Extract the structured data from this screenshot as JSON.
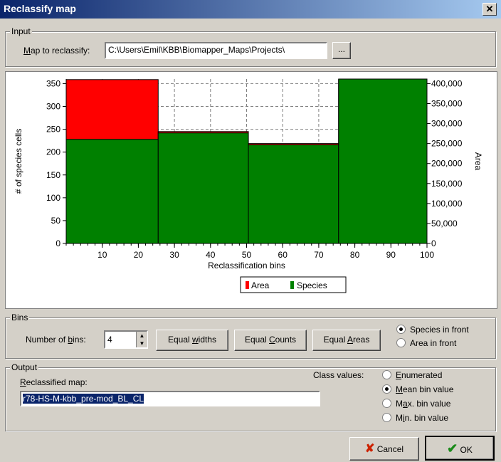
{
  "window": {
    "title": "Reclassify map",
    "close_glyph": "✕"
  },
  "input": {
    "group_label": "Input",
    "map_label_u": "M",
    "map_label_rest": "ap to reclassify:",
    "map_value": "C:\\Users\\Emil\\KBB\\Biomapper_Maps\\Projects\\",
    "browse_label": "..."
  },
  "chart_data": {
    "type": "bar",
    "xlabel": "Reclassification bins",
    "ylabel": "# of species cells",
    "y2label": "Area",
    "xlim": [
      0,
      100
    ],
    "ylim": [
      0,
      360
    ],
    "y2lim": [
      0,
      411429
    ],
    "xticks": [
      10,
      20,
      30,
      40,
      50,
      60,
      70,
      80,
      90,
      100
    ],
    "yticks": [
      0,
      50,
      100,
      150,
      200,
      250,
      300,
      350
    ],
    "y2ticks": [
      "0",
      "50,000",
      "100,000",
      "150,000",
      "200,000",
      "250,000",
      "300,000",
      "350,000",
      "400,000"
    ],
    "y2tick_values": [
      0,
      50000,
      100000,
      150000,
      200000,
      250000,
      300000,
      350000,
      400000
    ],
    "bins": [
      [
        0,
        25.5
      ],
      [
        25.5,
        50.5
      ],
      [
        50.5,
        75.5
      ],
      [
        75.5,
        100
      ]
    ],
    "series": [
      {
        "name": "Area",
        "color": "#ff0000",
        "axis": "right",
        "values": [
          410000,
          280000,
          250000,
          410000
        ]
      },
      {
        "name": "Species",
        "color": "#008000",
        "axis": "left",
        "values": [
          228,
          242,
          216,
          360
        ]
      }
    ],
    "grid": true,
    "legend_position": "bottom"
  },
  "bins": {
    "group_label": "Bins",
    "num_label_pre": "Number of ",
    "num_label_u": "b",
    "num_label_post": "ins:",
    "num_value": "4",
    "equal_widths": {
      "pre": "Equal ",
      "u": "w",
      "post": "idths"
    },
    "equal_counts": {
      "pre": "Equal ",
      "u": "C",
      "post": "ounts"
    },
    "equal_areas": {
      "pre": "Equal ",
      "u": "A",
      "post": "reas"
    },
    "front_options": [
      {
        "label": "Species in front",
        "selected": true
      },
      {
        "label": "Area in front",
        "selected": false
      }
    ]
  },
  "output": {
    "group_label": "Output",
    "reclassified_u": "R",
    "reclassified_rest": "eclassified map:",
    "map_value": "r78-HS-M-kbb_pre-mod_BL_CL",
    "class_values_label": "Class values:",
    "class_options": [
      {
        "u": "E",
        "rest": "numerated",
        "pre": "",
        "selected": false
      },
      {
        "u": "M",
        "rest": "ean bin value",
        "pre": "",
        "selected": true
      },
      {
        "u": "a",
        "rest": "x. bin value",
        "pre": "M",
        "selected": false
      },
      {
        "u": "i",
        "rest": "n. bin value",
        "pre": "M",
        "selected": false
      }
    ]
  },
  "footer": {
    "cancel_label": "Cancel",
    "ok_label": "OK",
    "cancel_color": "#cc2200",
    "ok_color": "#1a8a1a"
  }
}
